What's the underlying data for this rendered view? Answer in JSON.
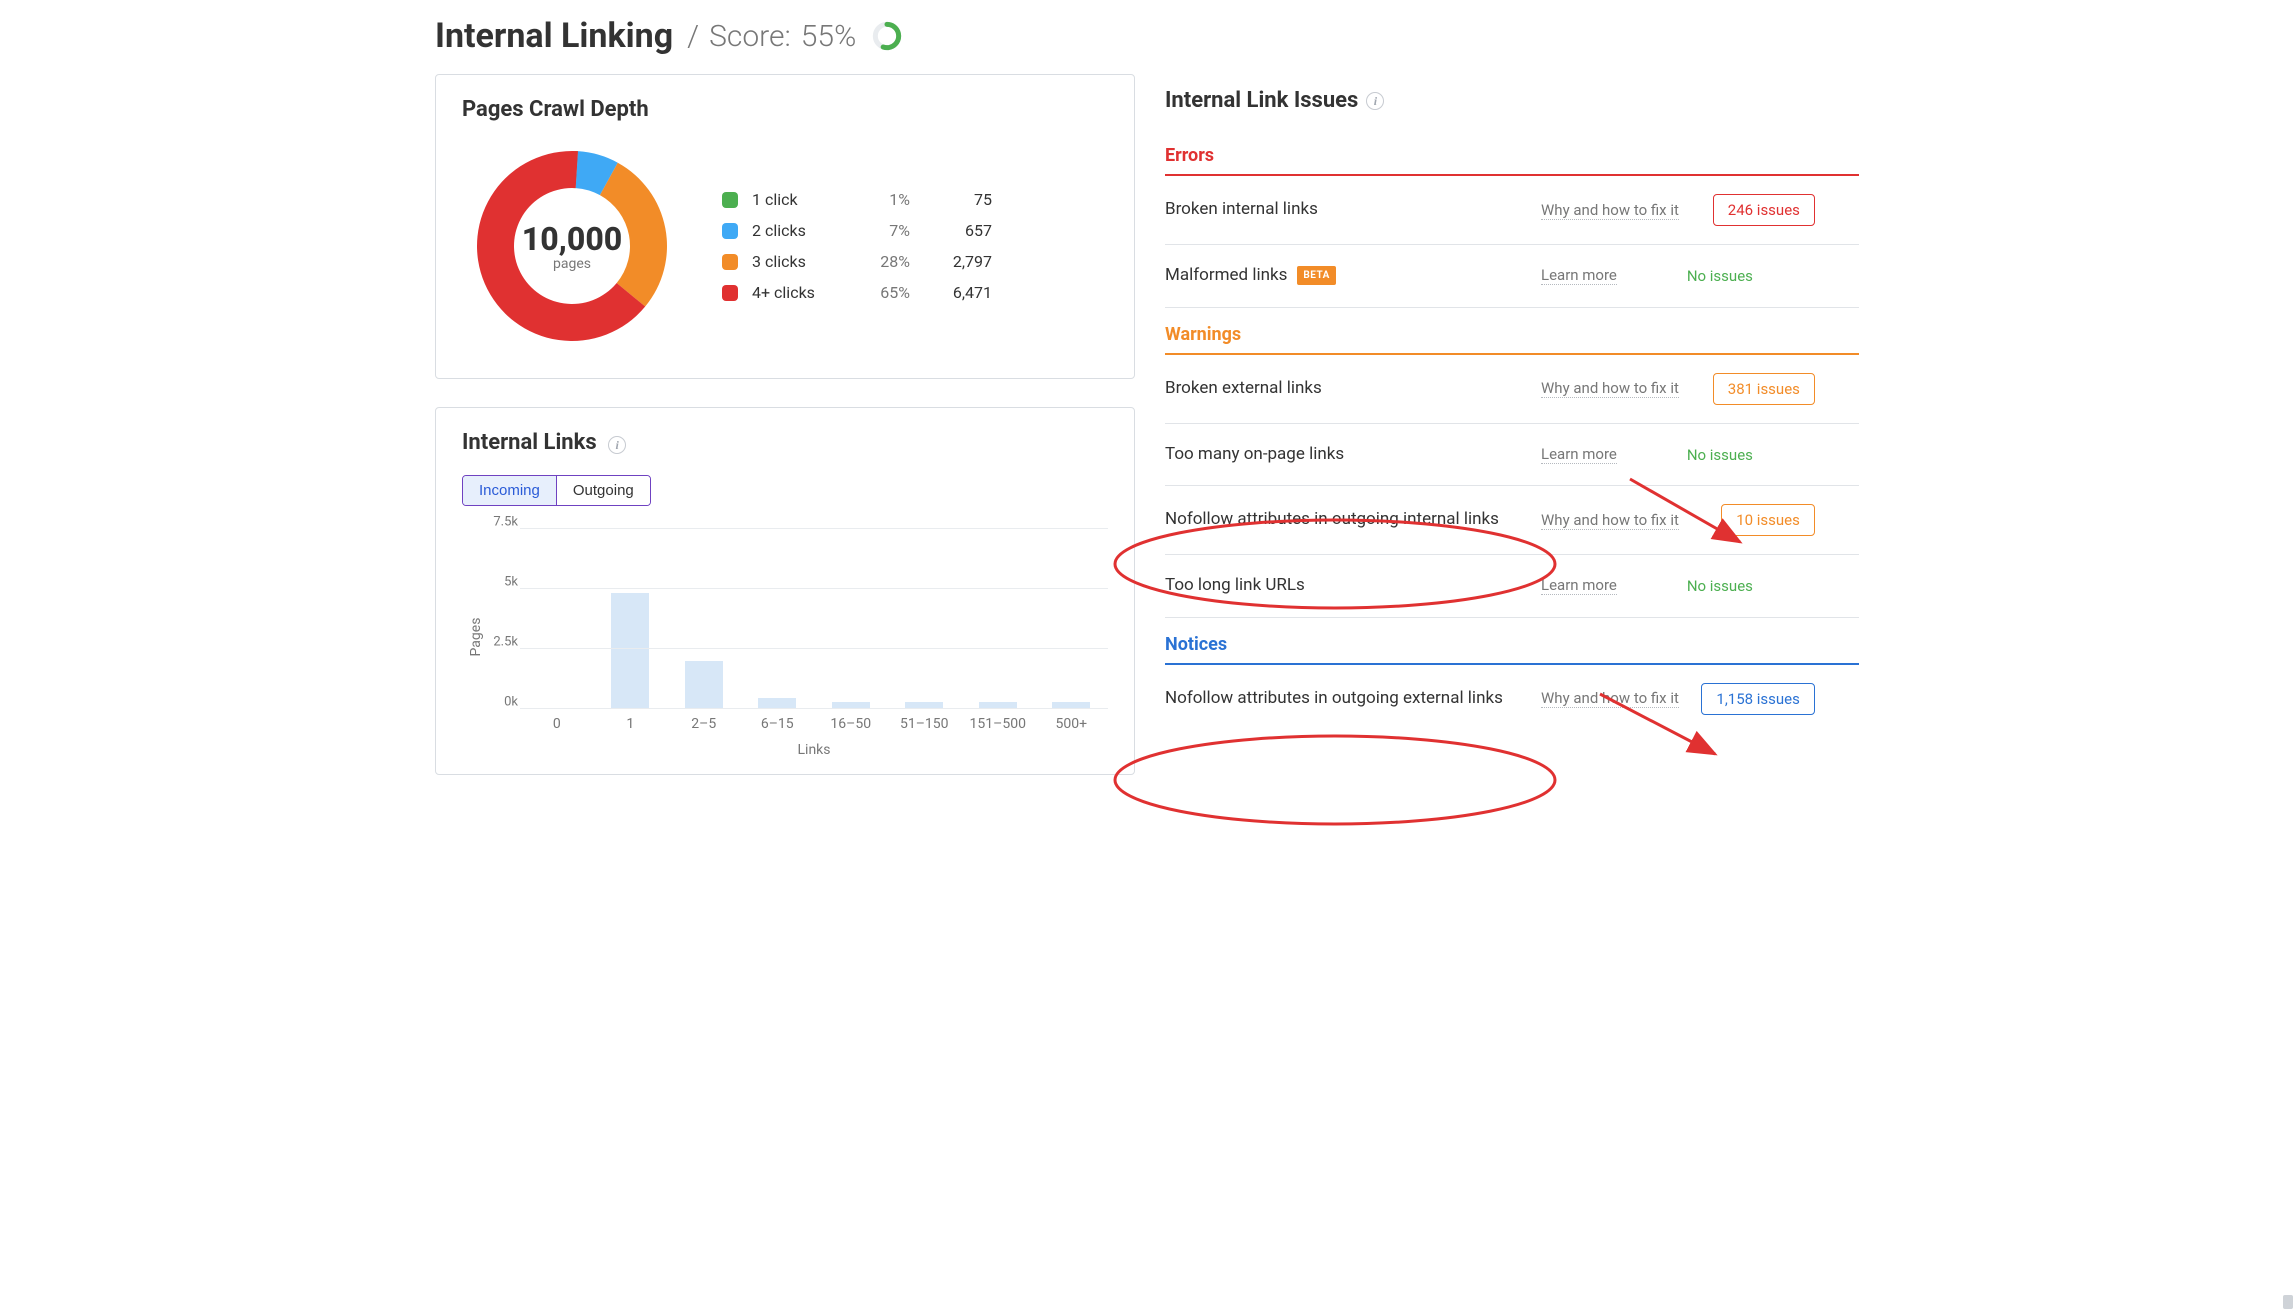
{
  "header": {
    "title": "Internal Linking",
    "score_label": "Score:",
    "score_value": "55%",
    "score_percent": 55
  },
  "crawl_depth": {
    "title": "Pages Crawl Depth",
    "total_label": "pages",
    "total": "10,000",
    "legend": [
      {
        "label": "1 click",
        "percent": "1%",
        "count": "75",
        "color": "#4caf50",
        "value": 1
      },
      {
        "label": "2 clicks",
        "percent": "7%",
        "count": "657",
        "color": "#3fa9f5",
        "value": 7
      },
      {
        "label": "3 clicks",
        "percent": "28%",
        "count": "2,797",
        "color": "#f28c28",
        "value": 28
      },
      {
        "label": "4+ clicks",
        "percent": "65%",
        "count": "6,471",
        "color": "#e03131",
        "value": 65
      }
    ]
  },
  "internal_links": {
    "title": "Internal Links",
    "tabs": {
      "incoming": "Incoming",
      "outgoing": "Outgoing",
      "active": "incoming"
    },
    "y_label": "Pages",
    "x_label": "Links",
    "y_ticks": [
      "7.5k",
      "5k",
      "2.5k",
      "0k"
    ],
    "y_max": 7500,
    "bars": [
      {
        "label": "0",
        "value": 0
      },
      {
        "label": "1",
        "value": 4800
      },
      {
        "label": "2–5",
        "value": 1950
      },
      {
        "label": "6–15",
        "value": 400
      },
      {
        "label": "16–50",
        "value": 250
      },
      {
        "label": "51–150",
        "value": 250
      },
      {
        "label": "151–500",
        "value": 250
      },
      {
        "label": "500+",
        "value": 250
      }
    ]
  },
  "issues": {
    "title": "Internal Link Issues",
    "no_issues_text": "No issues",
    "help_why": "Why and how to fix it",
    "help_learn": "Learn more",
    "beta_label": "BETA",
    "sections": [
      {
        "key": "errors",
        "label": "Errors",
        "color": "red",
        "items": [
          {
            "name": "Broken internal links",
            "help": "why",
            "count": "246 issues"
          },
          {
            "name": "Malformed links",
            "help": "learn",
            "beta": true,
            "count": null
          }
        ]
      },
      {
        "key": "warnings",
        "label": "Warnings",
        "color": "orange",
        "items": [
          {
            "name": "Broken external links",
            "help": "why",
            "count": "381 issues"
          },
          {
            "name": "Too many on-page links",
            "help": "learn",
            "count": null
          },
          {
            "name": "Nofollow attributes in outgoing internal links",
            "help": "why",
            "count": "10 issues"
          },
          {
            "name": "Too long link URLs",
            "help": "learn",
            "count": null
          }
        ]
      },
      {
        "key": "notices",
        "label": "Notices",
        "color": "blue",
        "items": [
          {
            "name": "Nofollow attributes in outgoing external links",
            "help": "why",
            "count": "1,158 issues"
          }
        ]
      }
    ]
  },
  "chart_data": [
    {
      "type": "pie",
      "title": "Pages Crawl Depth",
      "categories": [
        "1 click",
        "2 clicks",
        "3 clicks",
        "4+ clicks"
      ],
      "values": [
        75,
        657,
        2797,
        6471
      ],
      "percents": [
        1,
        7,
        28,
        65
      ],
      "total": 10000,
      "colors": [
        "#4caf50",
        "#3fa9f5",
        "#f28c28",
        "#e03131"
      ]
    },
    {
      "type": "bar",
      "title": "Internal Links — Incoming",
      "xlabel": "Links",
      "ylabel": "Pages",
      "categories": [
        "0",
        "1",
        "2–5",
        "6–15",
        "16–50",
        "51–150",
        "151–500",
        "500+"
      ],
      "values": [
        0,
        4800,
        1950,
        400,
        250,
        250,
        250,
        250
      ],
      "ylim": [
        0,
        7500
      ]
    }
  ]
}
